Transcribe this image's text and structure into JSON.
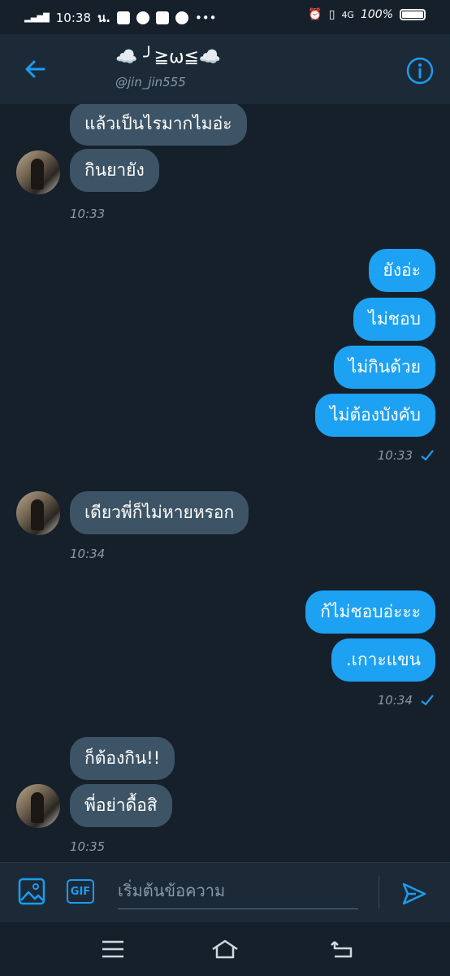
{
  "status": {
    "time": "10:38",
    "carrier_text": "น.",
    "network": "4G",
    "battery": "100%"
  },
  "header": {
    "title": "☁️ ╯≧ω≦☁️",
    "handle": "@jin_jin555"
  },
  "messages": [
    {
      "text": "แล้วเป็นไรมากไมอ่ะ",
      "side": "in"
    },
    {
      "text": "กินยายัง",
      "side": "in"
    },
    {
      "text": "10:33",
      "side": "time-in"
    },
    {
      "text": "ยังอ่ะ",
      "side": "out"
    },
    {
      "text": "ไม่ชอบ",
      "side": "out"
    },
    {
      "text": "ไม่กินด้วย",
      "side": "out"
    },
    {
      "text": "ไม่ต้องบังคับ",
      "side": "out"
    },
    {
      "text": "10:33",
      "side": "time-out"
    },
    {
      "text": "เดียวพี่ก็ไม่หายหรอก",
      "side": "in"
    },
    {
      "text": "10:34",
      "side": "time-in"
    },
    {
      "text": "ก้ไม่ชอบอ่ะะะ",
      "side": "out"
    },
    {
      "text": ".เกาะแขน",
      "side": "out"
    },
    {
      "text": "10:34",
      "side": "time-out"
    },
    {
      "text": "ก็ต้องกิน!!",
      "side": "in"
    },
    {
      "text": "พี่อย่าดื้อสิ",
      "side": "in"
    },
    {
      "text": "10:35",
      "side": "time-in"
    }
  ],
  "composer": {
    "placeholder": "เริ่มต้นข้อความ",
    "gif_label": "GIF"
  },
  "colors": {
    "accent": "#1da1f2",
    "incoming": "#3d5466",
    "background": "#15202b"
  }
}
